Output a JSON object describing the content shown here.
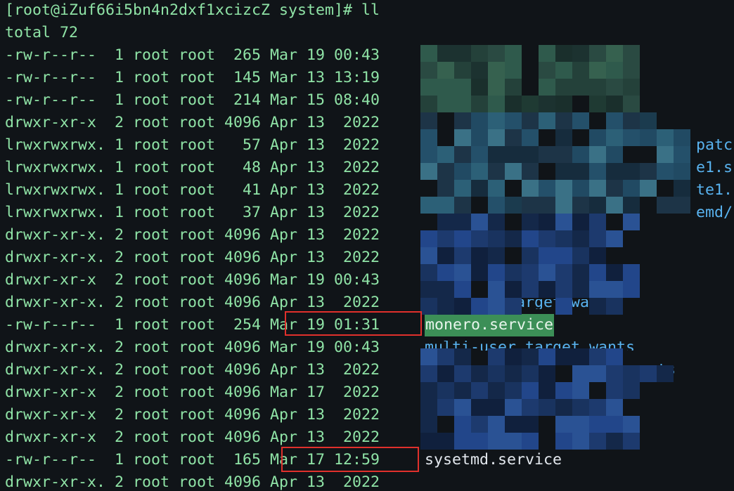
{
  "terminal": {
    "prompt": "[root@iZuf66i5bn4n2dxf1xcizcZ system]# ll",
    "total": "total 72",
    "rows": [
      {
        "perm": "-rw-r--r--  1 root root  265 Mar 19 00:43",
        "name": ""
      },
      {
        "perm": "-rw-r--r--  1 root root  145 Mar 13 13:19",
        "name": ""
      },
      {
        "perm": "-rw-r--r--  1 root root  214 Mar 15 08:40",
        "name": ""
      },
      {
        "perm": "drwxr-xr-x  2 root root 4096 Apr 13  2022",
        "name": ""
      },
      {
        "perm": "lrwxrwxrwx. 1 root root   57 Apr 13  2022",
        "name": ""
      },
      {
        "perm": "lrwxrwxrwx. 1 root root   48 Apr 13  2022",
        "name": ""
      },
      {
        "perm": "lrwxrwxrwx. 1 root root   41 Apr 13  2022",
        "name": ""
      },
      {
        "perm": "lrwxrwxrwx. 1 root root   37 Apr 13  2022",
        "name": ""
      },
      {
        "perm": "drwxr-xr-x. 2 root root 4096 Apr 13  2022",
        "name": ""
      },
      {
        "perm": "drwxr-xr-x. 2 root root 4096 Apr 13  2022",
        "name": ""
      },
      {
        "perm": "drwxr-xr-x  2 root root 4096 Mar 19 00:43",
        "name": ""
      },
      {
        "perm": "drwxr-xr-x. 2 root root 4096 Apr 13  2022",
        "name": ""
      },
      {
        "perm": "-rw-r--r--  1 root root  254 ",
        "date": "Mar 19 01:31",
        "name": "monero.service"
      },
      {
        "perm": "drwxr-xr-x. 2 root root 4096 Mar 19 00:43",
        "name": ""
      },
      {
        "perm": "drwxr-xr-x. 2 root root 4096 Apr 13  2022",
        "name": ""
      },
      {
        "perm": "drwxr-xr-x  2 root root 4096 Mar 17  2022",
        "name": ""
      },
      {
        "perm": "drwxr-xr-x  2 root root 4096 Apr 13  2022",
        "name": ""
      },
      {
        "perm": "drwxr-xr-x  2 root root 4096 Apr 13  2022",
        "name": ""
      },
      {
        "perm": "-rw-r--r--  1 root root  165 ",
        "date": "Mar 17 12:59",
        "name": "sysetmd.service"
      },
      {
        "perm": "drwxr-xr-x. 2 root root 4096 Apr 13  2022",
        "name": ""
      }
    ],
    "partial_names": {
      "row5": "patc",
      "row6": "e1.s",
      "row7": "te1.",
      "row8": "emd/",
      "row12": "iprutils.target.wants",
      "row14": "multi-user.target.wants",
      "row15": "ts"
    }
  },
  "colors": {
    "background": "#101418",
    "text_green": "#8fe3a6",
    "text_blue": "#59b3f0",
    "highlight": "#3c8f57",
    "annotation_red": "#e0302c"
  }
}
